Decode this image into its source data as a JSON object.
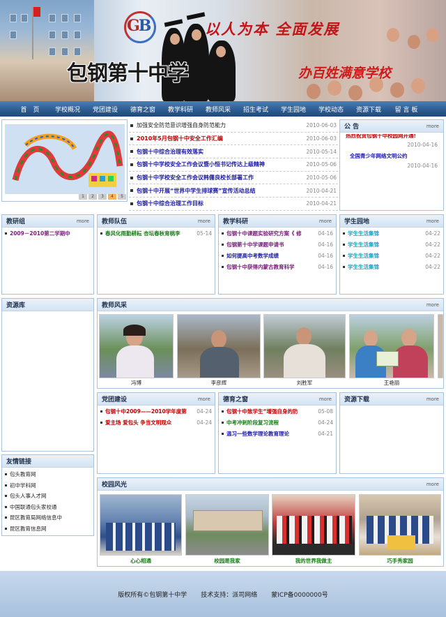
{
  "header": {
    "logo_letters_1": "G",
    "logo_letters_2": "B",
    "slogan_1": "以人为本  全面发展",
    "school_name": "包钢第十中学",
    "slogan_2": "办百姓满意学校"
  },
  "nav": {
    "items": [
      "首　页",
      "学校概况",
      "党团建设",
      "德育之窗",
      "教学科研",
      "教师风采",
      "招生考试",
      "学生园地",
      "学校动态",
      "资源下载",
      "留 言 板"
    ]
  },
  "slider": {
    "pages": [
      "1",
      "2",
      "3",
      "4",
      "5"
    ],
    "active": 4
  },
  "news": [
    {
      "title": "加强安全防范意识增强自身防范能力",
      "date": "2010-06-03",
      "color": "#222222"
    },
    {
      "title": "2010年5月包钢十中安全工作汇编",
      "date": "2010-06-03",
      "color": "#c00000"
    },
    {
      "title": "包钢十中综合治理有效落实",
      "date": "2010-05-14",
      "color": "#1a1aa6"
    },
    {
      "title": "包钢十中学校安全工作会议暨小恒书记传达上级精神",
      "date": "2010-05-06",
      "color": "#1a1aa6"
    },
    {
      "title": "包钢十中学校安全工作会议韩儒良校长部署工作",
      "date": "2010-05-06",
      "color": "#1a1aa6"
    },
    {
      "title": "包钢十中开展“世界中学生排球赛”宣传活动总结",
      "date": "2010-04-21",
      "color": "#1a1aa6"
    },
    {
      "title": "包钢十中综合治理工作目标",
      "date": "2010-04-21",
      "color": "#1a1aa6"
    }
  ],
  "notice": {
    "title": "公 告",
    "more": "more",
    "items": [
      {
        "title": "热烈祝贺包钢十中校园网开通!",
        "date": "2010-04-16",
        "color": "#c00000"
      },
      {
        "title": "全国青少年网络文明公约",
        "date": "2010-04-16",
        "color": "#1a1aa6"
      }
    ]
  },
  "jiaoyanzu": {
    "title": "教研组",
    "more": "more",
    "items": [
      {
        "title": "2009－2010第二学期中",
        "color": "#7a1a7a"
      }
    ]
  },
  "jiaoshiduiwu": {
    "title": "教师队伍",
    "more": "more",
    "items": [
      {
        "title": "春风化雨勤耕耘 杏坛春秋育桃李",
        "date": "05-14",
        "color": "#1a7a1a"
      }
    ]
  },
  "jiaoxuekeyan": {
    "title": "教学科研",
    "more": "more",
    "items": [
      {
        "title": "包钢十中课题实验研究方案《 修",
        "date": "04-16",
        "color": "#7a1a7a"
      },
      {
        "title": "包钢第十中学课题申请书",
        "date": "04-16",
        "color": "#7a1a7a"
      },
      {
        "title": "如何提高中考数学成绩",
        "date": "04-16",
        "color": "#1a1aa6"
      },
      {
        "title": "包钢十中获得内蒙古教育科学",
        "date": "04-16",
        "color": "#7a1a7a"
      }
    ]
  },
  "xueshengyuandi": {
    "title": "学生园地",
    "more": "more",
    "items": [
      {
        "title": "学生生活集锦",
        "date": "04-22",
        "color": "#19a5c4"
      },
      {
        "title": "学生生活集锦",
        "date": "04-22",
        "color": "#19a5c4"
      },
      {
        "title": "学生生活集锦",
        "date": "04-22",
        "color": "#19a5c4"
      },
      {
        "title": "学生生活集锦",
        "date": "04-22",
        "color": "#19a5c4"
      }
    ]
  },
  "ziyuanku": {
    "title": "资源库"
  },
  "jiaoshifengcai": {
    "title": "教师风采",
    "more": "more",
    "photos": [
      "冯博",
      "李彦辉",
      "刘胜军",
      "王艳丽"
    ]
  },
  "dangtuan": {
    "title": "党团建设",
    "more": "more",
    "items": [
      {
        "title": "包钢十中2009——2010学年度第",
        "date": "04-24",
        "color": "#c00000"
      },
      {
        "title": "爱主场 爱包头 争当文明观众",
        "date": "04-24",
        "color": "#c00000"
      }
    ]
  },
  "deyu": {
    "title": "德育之窗",
    "more": "more",
    "items": [
      {
        "title": "包钢十中致学生“增强自身的防",
        "date": "05-08",
        "color": "#c00000"
      },
      {
        "title": "中考冲刺阶段复习流程",
        "date": "04-24",
        "color": "#1a7a1a"
      },
      {
        "title": "温习一些数学理论教育理论",
        "date": "04-21",
        "color": "#1a1aa6"
      }
    ]
  },
  "ziyuanxiazai": {
    "title": "资源下载",
    "more": "more"
  },
  "links": {
    "title": "友情链接",
    "items": [
      "包头教育网",
      "初中学科网",
      "包头人事人才网",
      "中国联通包头家校通",
      "昆区教育局网络信息中",
      "昆区教育信息网"
    ]
  },
  "xiaoyuan": {
    "title": "校园风光",
    "more": "more",
    "photos": [
      "心心相通",
      "校园是我家",
      "我的世界我做主",
      "巧手秀家园"
    ]
  },
  "footer": {
    "copyright": "版权所有©包钢第十中学",
    "support": "技术支持：派司网络",
    "icp": "蒙ICP备0000000号"
  }
}
